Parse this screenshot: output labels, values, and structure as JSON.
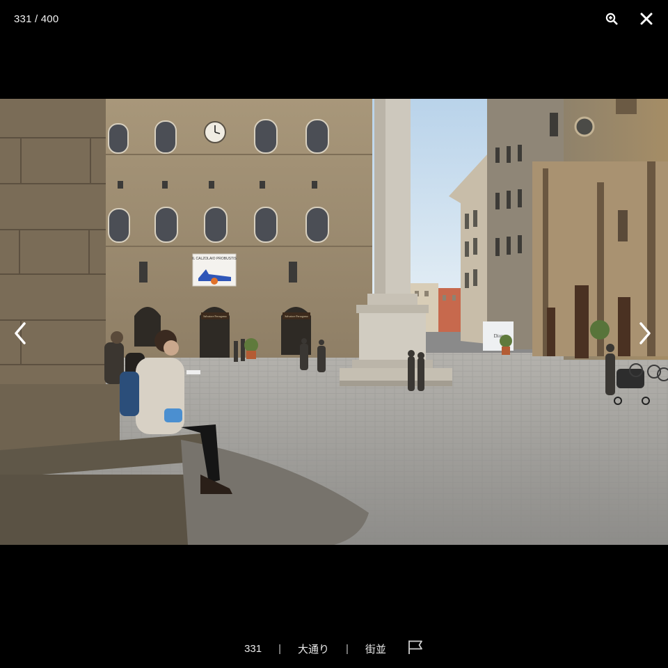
{
  "viewer": {
    "counter": "331 / 400",
    "current": 331,
    "total": 400
  },
  "toolbar": {
    "zoom_icon": "zoom-in-icon",
    "close_icon": "close-icon"
  },
  "navigation": {
    "prev_icon": "chevron-left-icon",
    "next_icon": "chevron-right-icon"
  },
  "photo": {
    "banner_text": "IL CALZOLAIO PROBUSTIS",
    "shop_sign_left": "Salvatore Ferragamo",
    "shop_sign_right": "Salvatore Ferragamo",
    "hoarding_text": "Dior"
  },
  "caption": {
    "number": "331",
    "separator": "|",
    "category": "大通り",
    "tag": "街並",
    "report_icon": "flag-icon"
  },
  "colors": {
    "background": "#000000",
    "text": "#ffffff",
    "sky": "#cfe0ef",
    "stone": "#9c8b6f",
    "pavement": "#9a9a9a"
  }
}
